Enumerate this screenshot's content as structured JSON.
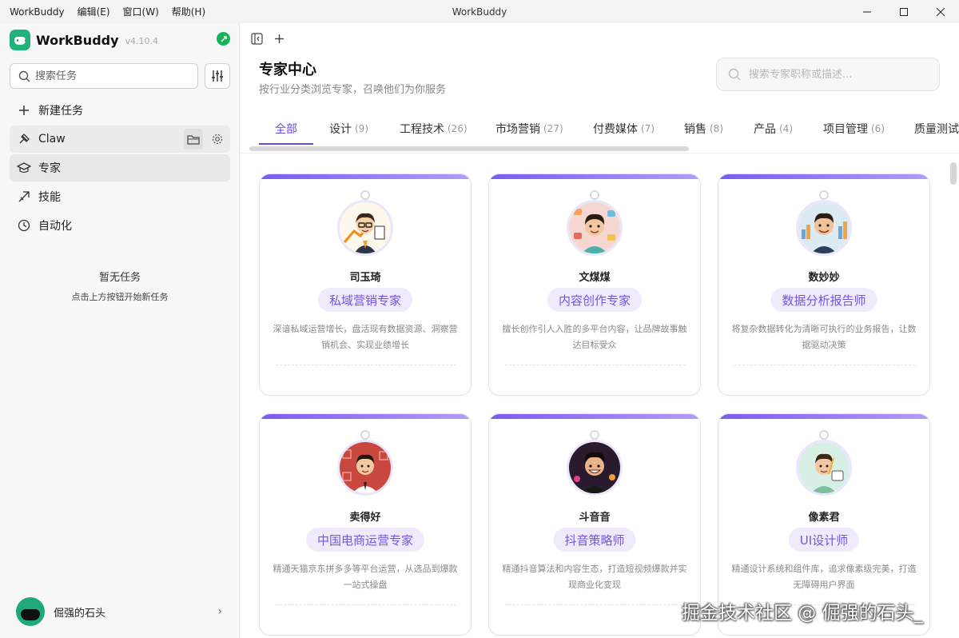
{
  "window": {
    "title": "WorkBuddy",
    "menu": [
      "WorkBuddy",
      "编辑(E)",
      "窗口(W)",
      "帮助(H)"
    ]
  },
  "sidebar": {
    "brand": "WorkBuddy",
    "version": "v4.10.4",
    "search_placeholder": "搜索任务",
    "nav": [
      {
        "label": "新建任务",
        "icon": "plus-icon"
      },
      {
        "label": "Claw",
        "icon": "claw-icon"
      },
      {
        "label": "专家",
        "icon": "graduation-cap-icon"
      },
      {
        "label": "技能",
        "icon": "skill-icon"
      },
      {
        "label": "自动化",
        "icon": "clock-icon"
      }
    ],
    "empty_title": "暂无任务",
    "empty_sub": "点击上方按钮开始新任务",
    "user_name": "倔强的石头"
  },
  "main": {
    "title": "专家中心",
    "subtitle": "按行业分类浏览专家，召唤他们为你服务",
    "search_placeholder": "搜索专家职称或描述...",
    "tabs": [
      {
        "label": "全部",
        "count": ""
      },
      {
        "label": "设计",
        "count": "(9)"
      },
      {
        "label": "工程技术",
        "count": "(26)"
      },
      {
        "label": "市场营销",
        "count": "(27)"
      },
      {
        "label": "付费媒体",
        "count": "(7)"
      },
      {
        "label": "销售",
        "count": "(8)"
      },
      {
        "label": "产品",
        "count": "(4)"
      },
      {
        "label": "项目管理",
        "count": "(6)"
      },
      {
        "label": "质量测试",
        "count": ""
      }
    ],
    "cards": [
      {
        "name": "司玉琦",
        "role": "私域营销专家",
        "desc": "深谙私域运营增长，盘活现有数据资源、洞察营销机会、实现业绩增长"
      },
      {
        "name": "文煤煤",
        "role": "内容创作专家",
        "desc": "擅长创作引人入胜的多平台内容，让品牌故事触达目标受众"
      },
      {
        "name": "数妙妙",
        "role": "数据分析报告师",
        "desc": "将复杂数据转化为清晰可执行的业务报告，让数据驱动决策"
      },
      {
        "name": "卖得好",
        "role": "中国电商运营专家",
        "desc": "精通天猫京东拼多多等平台运营，从选品到爆款一站式操盘"
      },
      {
        "name": "斗音音",
        "role": "抖音策略师",
        "desc": "精通抖音算法和内容生态，打造短视频爆款并实现商业化变现"
      },
      {
        "name": "像素君",
        "role": "UI设计师",
        "desc": "精通设计系统和组件库，追求像素级完美，打造无障碍用户界面"
      }
    ]
  },
  "watermark": "掘金技术社区 @ 倔强的石头_",
  "colors": {
    "accent": "#6b46e5",
    "role_bg": "#efebfc",
    "brand_green": "#1fb27a"
  }
}
